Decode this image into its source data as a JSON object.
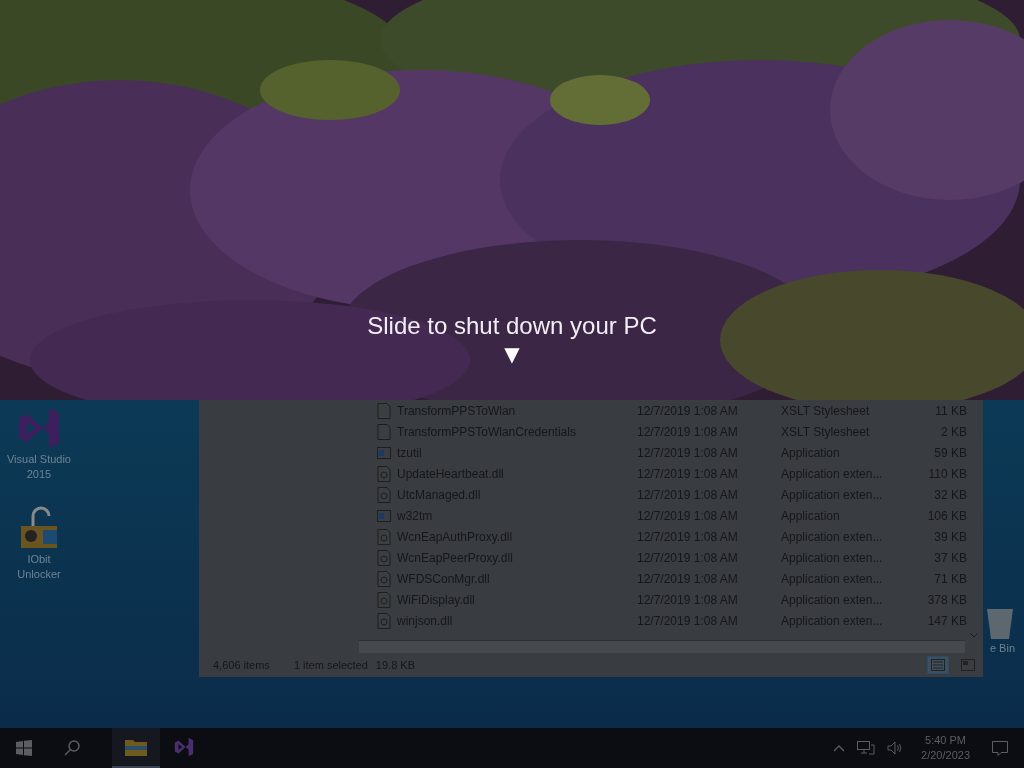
{
  "shutdown_overlay": {
    "prompt": "Slide to shut down your PC",
    "arrow": "▼"
  },
  "desktop_icons": [
    {
      "label": "Visual Studio\n2015",
      "kind": "vs"
    },
    {
      "label": "IObit\nUnlocker",
      "kind": "lock"
    },
    {
      "label": "e Bin",
      "kind": "bin"
    }
  ],
  "explorer": {
    "files": [
      {
        "name": "TransformPPSToWlan",
        "date": "12/7/2019 1:08 AM",
        "type": "XSLT Stylesheet",
        "size": "11 KB",
        "kind": "doc"
      },
      {
        "name": "TransformPPSToWlanCredentials",
        "date": "12/7/2019 1:08 AM",
        "type": "XSLT Stylesheet",
        "size": "2 KB",
        "kind": "doc"
      },
      {
        "name": "tzutil",
        "date": "12/7/2019 1:08 AM",
        "type": "Application",
        "size": "59 KB",
        "kind": "app"
      },
      {
        "name": "UpdateHeartbeat.dll",
        "date": "12/7/2019 1:08 AM",
        "type": "Application exten...",
        "size": "110 KB",
        "kind": "dll"
      },
      {
        "name": "UtcManaged.dll",
        "date": "12/7/2019 1:08 AM",
        "type": "Application exten...",
        "size": "32 KB",
        "kind": "dll"
      },
      {
        "name": "w32tm",
        "date": "12/7/2019 1:08 AM",
        "type": "Application",
        "size": "106 KB",
        "kind": "app"
      },
      {
        "name": "WcnEapAuthProxy.dll",
        "date": "12/7/2019 1:08 AM",
        "type": "Application exten...",
        "size": "39 KB",
        "kind": "dll"
      },
      {
        "name": "WcnEapPeerProxy.dll",
        "date": "12/7/2019 1:08 AM",
        "type": "Application exten...",
        "size": "37 KB",
        "kind": "dll"
      },
      {
        "name": "WFDSConMgr.dll",
        "date": "12/7/2019 1:08 AM",
        "type": "Application exten...",
        "size": "71 KB",
        "kind": "dll"
      },
      {
        "name": "WiFiDisplay.dll",
        "date": "12/7/2019 1:08 AM",
        "type": "Application exten...",
        "size": "378 KB",
        "kind": "dll"
      },
      {
        "name": "winjson.dll",
        "date": "12/7/2019 1:08 AM",
        "type": "Application exten...",
        "size": "147 KB",
        "kind": "dll"
      }
    ],
    "status": {
      "items": "4,606 items",
      "selected": "1 item selected",
      "size": "19.8 KB"
    },
    "views": [
      {
        "kind": "details",
        "selected": true
      },
      {
        "kind": "tiles",
        "selected": false
      }
    ]
  },
  "taskbar": {
    "apps": [
      {
        "kind": "explorer",
        "selected": true
      },
      {
        "kind": "vs",
        "selected": false
      }
    ],
    "time": "5:40 PM",
    "date": "2/20/2023"
  }
}
